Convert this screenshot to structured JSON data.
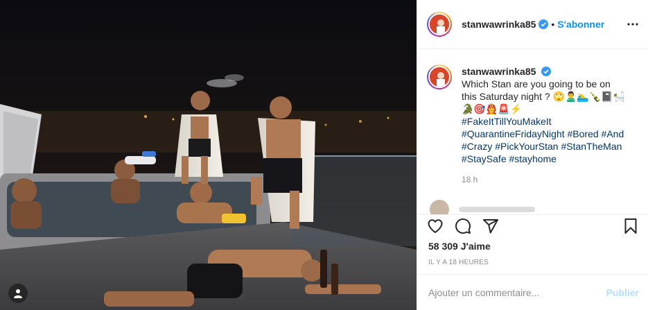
{
  "post": {
    "username": "stanwawrinka85",
    "separator": "•",
    "follow_label": "S'abonner",
    "caption": {
      "text": "Which Stan are you going to be on this Saturday night ? 🙄🙎‍♂️🏊‍♂️🍾📓🛀🐊🎯👨‍🚒🚨⚡",
      "hashtags": "#FakeItTillYouMakeIt #QuarantineFridayNight #Bored #And #Crazy #PickYourStan #StanTheMan #StaySafe #stayhome",
      "time_ago": "18 h"
    },
    "likes": "58 309 J'aime",
    "date": "IL Y A 18 HEURES",
    "comment_placeholder": "Ajouter un commentaire...",
    "publish_label": "Publier"
  },
  "icons": {
    "more": "more-options-icon",
    "verified": "verified-badge-icon",
    "like": "heart-icon",
    "comment": "comment-icon",
    "share": "share-icon",
    "save": "bookmark-icon",
    "tag": "user-tag-icon"
  },
  "colors": {
    "accent": "#0095f6",
    "hashtag": "#00376b",
    "secondary_text": "#8e8e8e",
    "publish_disabled": "#b2dffc"
  }
}
